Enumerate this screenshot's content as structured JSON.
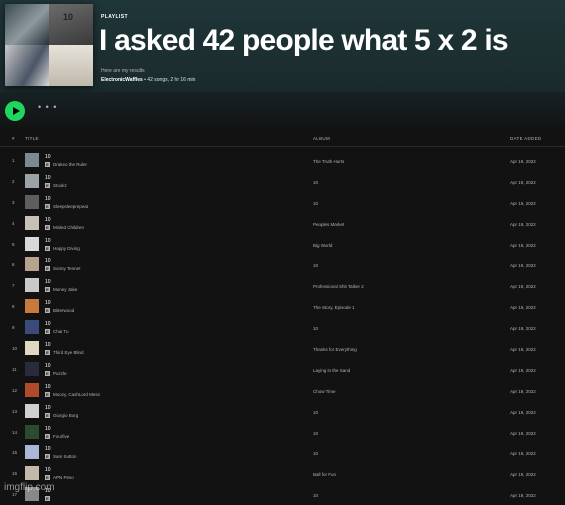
{
  "playlist": {
    "type_label": "PLAYLIST",
    "title": "I asked 42 people what 5 x 2 is",
    "description": "Here are my results",
    "owner": "ElectronicWaffles",
    "meta": " • 42 songs, 2 hr 16 min",
    "cover_text": "10"
  },
  "actions": {
    "more": "• • •"
  },
  "table": {
    "headers": {
      "index": "#",
      "title": "TITLE",
      "album": "ALBUM",
      "date": "DATE ADDED"
    },
    "rows": [
      {
        "index": "1",
        "title": "10",
        "artist": "Drakeo the Ruler",
        "album": "The Truth Hurts",
        "date": "Apr 19, 2022",
        "thumb_color": "#7a8a94"
      },
      {
        "index": "2",
        "title": "10",
        "artist": "Stookz",
        "album": "10",
        "date": "Apr 19, 2022",
        "thumb_color": "#9aa3a8"
      },
      {
        "index": "3",
        "title": "10",
        "artist": "Sleepsleeprepeat",
        "album": "10",
        "date": "Apr 19, 2022",
        "thumb_color": "#5e5e5e"
      },
      {
        "index": "4",
        "title": "10",
        "artist": "Misled Children",
        "album": "Peoples Market",
        "date": "Apr 19, 2022",
        "thumb_color": "#c8c2b6"
      },
      {
        "index": "5",
        "title": "10",
        "artist": "Happy Diving",
        "album": "Big World",
        "date": "Apr 19, 2022",
        "thumb_color": "#d9d9d9"
      },
      {
        "index": "6",
        "title": "10",
        "artist": "Sonny Tennet",
        "album": "10",
        "date": "Apr 19, 2022",
        "thumb_color": "#b8a48e"
      },
      {
        "index": "7",
        "title": "10",
        "artist": "Money Jake",
        "album": "Professional Shit Talker 2",
        "date": "Apr 19, 2022",
        "thumb_color": "#c9c9c9"
      },
      {
        "index": "8",
        "title": "10",
        "artist": "Bitterwood",
        "album": "The Story, Episode 1",
        "date": "Apr 19, 2022",
        "thumb_color": "#c77a3a"
      },
      {
        "index": "9",
        "title": "10",
        "artist": "Chai Tu",
        "album": "10",
        "date": "Apr 19, 2022",
        "thumb_color": "#3a4a7a"
      },
      {
        "index": "10",
        "title": "10",
        "artist": "Third Eye Blind",
        "album": "Thanks for Everything",
        "date": "Apr 19, 2022",
        "thumb_color": "#e0d8c0"
      },
      {
        "index": "11",
        "title": "10",
        "artist": "Puzzle",
        "album": "Laying in the Sand",
        "date": "Apr 19, 2022",
        "thumb_color": "#2a2a3a"
      },
      {
        "index": "12",
        "title": "10",
        "artist": "Moozy, CashLord Mess",
        "album": "Chow Time",
        "date": "Apr 19, 2022",
        "thumb_color": "#b04a2a"
      },
      {
        "index": "13",
        "title": "10",
        "artist": "Giorgio Borg",
        "album": "10",
        "date": "Apr 19, 2022",
        "thumb_color": "#d0d0d0"
      },
      {
        "index": "14",
        "title": "10",
        "artist": "Fourfive",
        "album": "10",
        "date": "Apr 19, 2022",
        "thumb_color": "#2c4a2c"
      },
      {
        "index": "15",
        "title": "10",
        "artist": "Sam Sutton",
        "album": "10",
        "date": "Apr 19, 2022",
        "thumb_color": "#aab8d8"
      },
      {
        "index": "16",
        "title": "10",
        "artist": "APN Peso",
        "album": "Ball for Fun",
        "date": "Apr 19, 2022",
        "thumb_color": "#c4b8a8"
      },
      {
        "index": "17",
        "title": "10",
        "artist": "",
        "album": "10",
        "date": "Apr 19, 2022",
        "thumb_color": "#888888"
      }
    ]
  },
  "watermark": "imgflip.com",
  "colors": {
    "accent": "#1ed760",
    "background": "#121212",
    "header": "#1f3638"
  }
}
